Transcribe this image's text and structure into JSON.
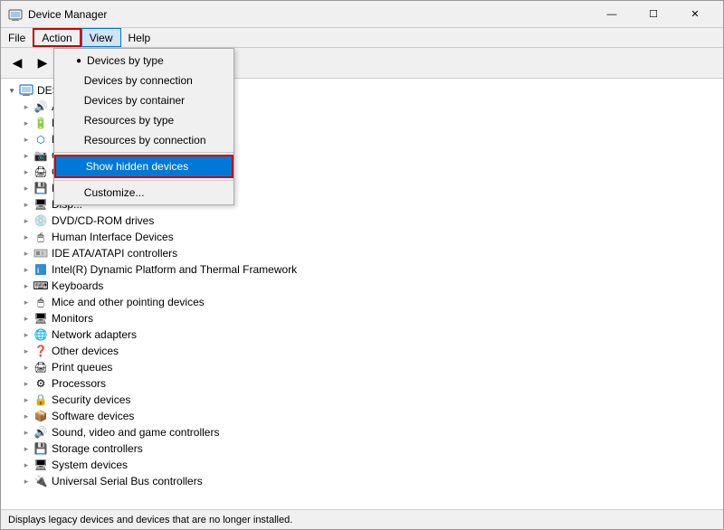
{
  "window": {
    "title": "Device Manager",
    "icon": "🖥",
    "controls": {
      "minimize": "—",
      "maximize": "☐",
      "close": "✕"
    }
  },
  "menubar": {
    "items": [
      {
        "label": "File",
        "id": "file"
      },
      {
        "label": "Action",
        "id": "action",
        "active": false
      },
      {
        "label": "View",
        "id": "view",
        "active": true
      },
      {
        "label": "Help",
        "id": "help"
      }
    ]
  },
  "toolbar": {
    "buttons": [
      {
        "icon": "◀",
        "title": "Back"
      },
      {
        "icon": "▶",
        "title": "Forward"
      },
      {
        "icon": "⊞",
        "title": "Properties"
      }
    ]
  },
  "view_menu": {
    "items": [
      {
        "label": "Devices by type",
        "checked": true,
        "id": "by-type"
      },
      {
        "label": "Devices by connection",
        "id": "by-connection"
      },
      {
        "label": "Devices by container",
        "id": "by-container"
      },
      {
        "label": "Resources by type",
        "id": "resources-by-type"
      },
      {
        "label": "Resources by connection",
        "id": "resources-by-connection"
      },
      {
        "separator": true
      },
      {
        "label": "Show hidden devices",
        "id": "show-hidden",
        "highlighted": true
      },
      {
        "separator": true
      },
      {
        "label": "Customize...",
        "id": "customize"
      }
    ]
  },
  "tree": {
    "root": {
      "label": "DESKTOP-...",
      "expanded": true,
      "icon": "💻",
      "children": [
        {
          "label": "Aud...",
          "icon": "🔊",
          "expandable": true
        },
        {
          "label": "Batt...",
          "icon": "🔋",
          "expandable": true
        },
        {
          "label": "Blue...",
          "icon": "⬡",
          "expandable": true
        },
        {
          "label": "Cam...",
          "icon": "📷",
          "expandable": true
        },
        {
          "label": "Com...",
          "icon": "🖨",
          "expandable": true
        },
        {
          "label": "Disk ...",
          "icon": "💾",
          "expandable": true
        },
        {
          "label": "Disp...",
          "icon": "🖥",
          "expandable": true
        },
        {
          "label": "DVD/CD-ROM drives",
          "icon": "💿",
          "expandable": true
        },
        {
          "label": "Human Interface Devices",
          "icon": "🖱",
          "expandable": true
        },
        {
          "label": "IDE ATA/ATAPI controllers",
          "icon": "⬜",
          "expandable": true
        },
        {
          "label": "Intel(R) Dynamic Platform and Thermal Framework",
          "icon": "⬜",
          "expandable": true
        },
        {
          "label": "Keyboards",
          "icon": "⌨",
          "expandable": true
        },
        {
          "label": "Mice and other pointing devices",
          "icon": "🖱",
          "expandable": true
        },
        {
          "label": "Monitors",
          "icon": "🖥",
          "expandable": true
        },
        {
          "label": "Network adapters",
          "icon": "🌐",
          "expandable": true
        },
        {
          "label": "Other devices",
          "icon": "❓",
          "expandable": true
        },
        {
          "label": "Print queues",
          "icon": "🖨",
          "expandable": true
        },
        {
          "label": "Processors",
          "icon": "⚙",
          "expandable": true
        },
        {
          "label": "Security devices",
          "icon": "🔒",
          "expandable": true
        },
        {
          "label": "Software devices",
          "icon": "📦",
          "expandable": true
        },
        {
          "label": "Sound, video and game controllers",
          "icon": "🔊",
          "expandable": true
        },
        {
          "label": "Storage controllers",
          "icon": "💾",
          "expandable": true
        },
        {
          "label": "System devices",
          "icon": "🖥",
          "expandable": true
        },
        {
          "label": "Universal Serial Bus controllers",
          "icon": "🔌",
          "expandable": true
        }
      ]
    }
  },
  "status": {
    "text": "Displays legacy devices and devices that are no longer installed."
  }
}
